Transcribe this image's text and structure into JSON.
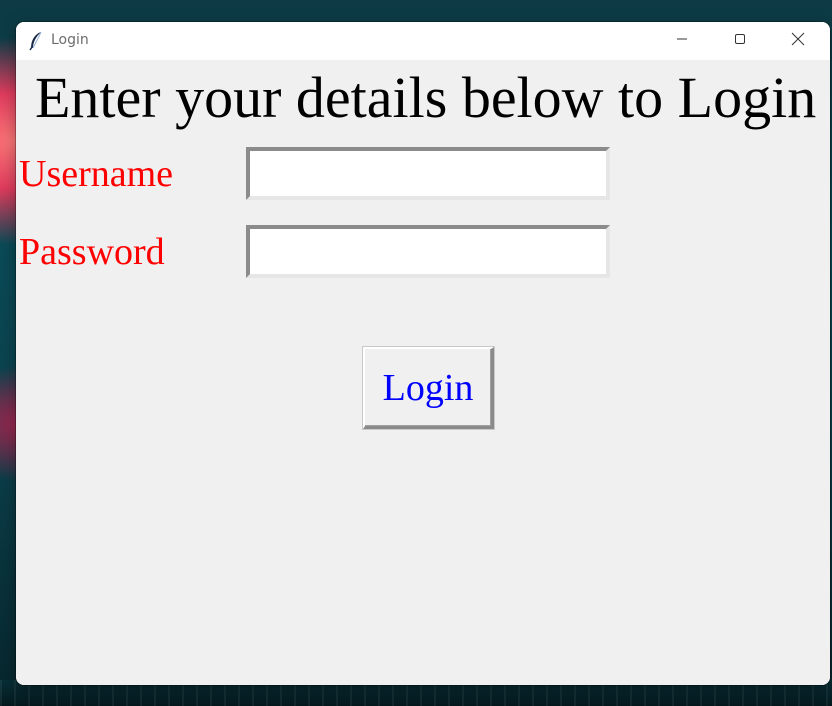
{
  "window": {
    "title": "Login",
    "app_icon": "feather-icon",
    "controls": [
      "minimize-icon",
      "maximize-icon",
      "close-icon"
    ]
  },
  "form": {
    "heading": "Enter your details below to Login",
    "username_label": "Username",
    "username_value": "",
    "password_label": "Password",
    "password_value": "",
    "login_button": "Login"
  },
  "colors": {
    "heading": "#000000",
    "label": "#ff0000",
    "button_text": "#0000ff",
    "window_background": "#f0f0f0"
  }
}
